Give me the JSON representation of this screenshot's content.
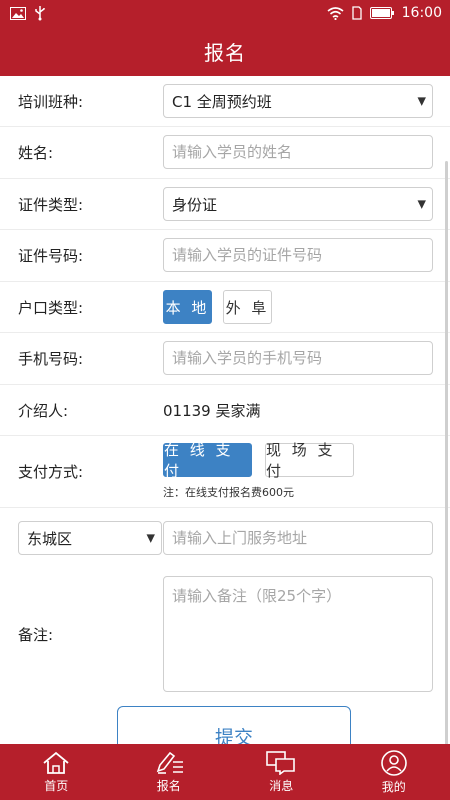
{
  "status": {
    "time": "16:00",
    "left_icons": [
      "image-icon",
      "usb-icon"
    ],
    "right_icons": [
      "wifi-icon",
      "sim-icon",
      "battery-icon"
    ]
  },
  "header": {
    "title": "报名"
  },
  "form": {
    "course": {
      "label": "培训班种:",
      "value": "C1 全周预约班"
    },
    "name": {
      "label": "姓名:",
      "placeholder": "请输入学员的姓名"
    },
    "id_type": {
      "label": "证件类型:",
      "value": "身份证"
    },
    "id_number": {
      "label": "证件号码:",
      "placeholder": "请输入学员的证件号码"
    },
    "hukou": {
      "label": "户口类型:",
      "options": [
        "本 地",
        "外 阜"
      ],
      "selected": "本 地"
    },
    "phone": {
      "label": "手机号码:",
      "placeholder": "请输入学员的手机号码"
    },
    "referrer": {
      "label": "介绍人:",
      "value": "01139 吴家满"
    },
    "payment": {
      "label": "支付方式:",
      "options": [
        "在 线 支 付",
        "现 场 支 付"
      ],
      "selected": "在 线 支 付",
      "note": "注：在线支付报名费600元"
    },
    "district": {
      "value": "东城区"
    },
    "address": {
      "placeholder": "请输入上门服务地址"
    },
    "remarks": {
      "label": "备注:",
      "placeholder": "请输入备注（限25个字）"
    },
    "submit_label": "提交"
  },
  "tabs": [
    {
      "label": "首页",
      "icon": "home-icon"
    },
    {
      "label": "报名",
      "icon": "edit-icon"
    },
    {
      "label": "消息",
      "icon": "message-icon"
    },
    {
      "label": "我的",
      "icon": "user-icon"
    }
  ],
  "colors": {
    "brand": "#b51f2b",
    "accent": "#3d82c4",
    "placeholder": "#a6a6a6"
  }
}
